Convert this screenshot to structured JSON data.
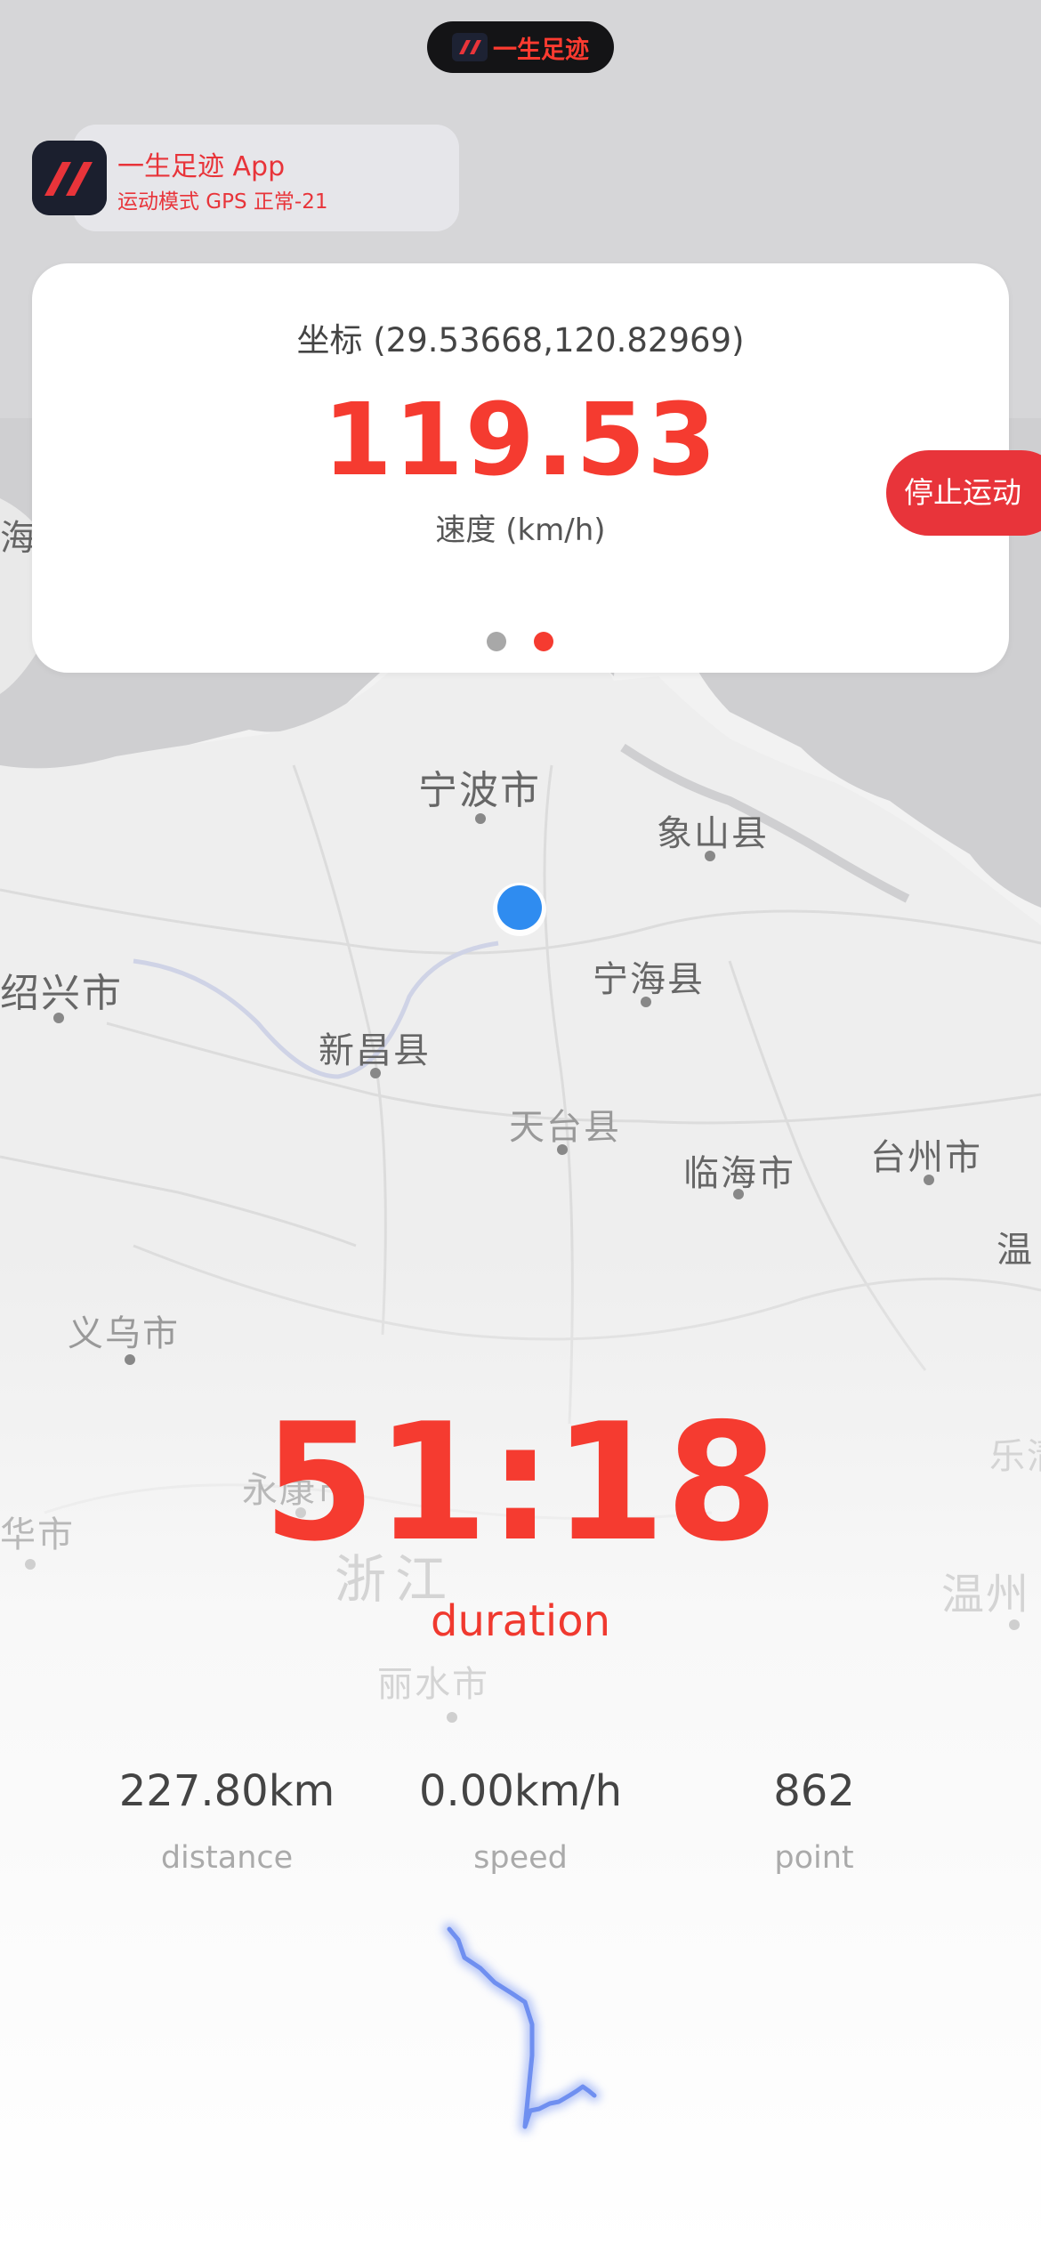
{
  "status_island": {
    "text": "一生足迹"
  },
  "notification": {
    "title": "一生足迹 App",
    "subtitle": "运动模式 GPS 正常-21"
  },
  "card": {
    "coordinate": "坐标 (29.53668,120.82969)",
    "speed_value": "119.53",
    "speed_unit": "速度 (km/h)",
    "pages": [
      {
        "active": false
      },
      {
        "active": true
      }
    ]
  },
  "stop_button": {
    "label": "停止运动"
  },
  "map": {
    "labels": [
      {
        "name": "宁波市"
      },
      {
        "name": "象山县"
      },
      {
        "name": "宁海县"
      },
      {
        "name": "绍兴市"
      },
      {
        "name": "新昌县"
      },
      {
        "name": "天台县"
      },
      {
        "name": "临海市"
      },
      {
        "name": "台州市"
      },
      {
        "name": "温"
      },
      {
        "name": "义乌市"
      },
      {
        "name": "永康市"
      },
      {
        "name": "华市"
      },
      {
        "name": "浙江"
      },
      {
        "name": "丽水市"
      },
      {
        "name": "乐清"
      },
      {
        "name": "温州"
      },
      {
        "name": "海"
      }
    ]
  },
  "workout": {
    "duration": "51:18",
    "duration_label": "duration",
    "stats": [
      {
        "value": "227.80km",
        "label": "distance"
      },
      {
        "value": "0.00km/h",
        "label": "speed"
      },
      {
        "value": "862",
        "label": "point"
      }
    ]
  },
  "colors": {
    "accent": "#f53b30",
    "location_dot": "#2f8cf0",
    "track": "#6f8ff0"
  }
}
